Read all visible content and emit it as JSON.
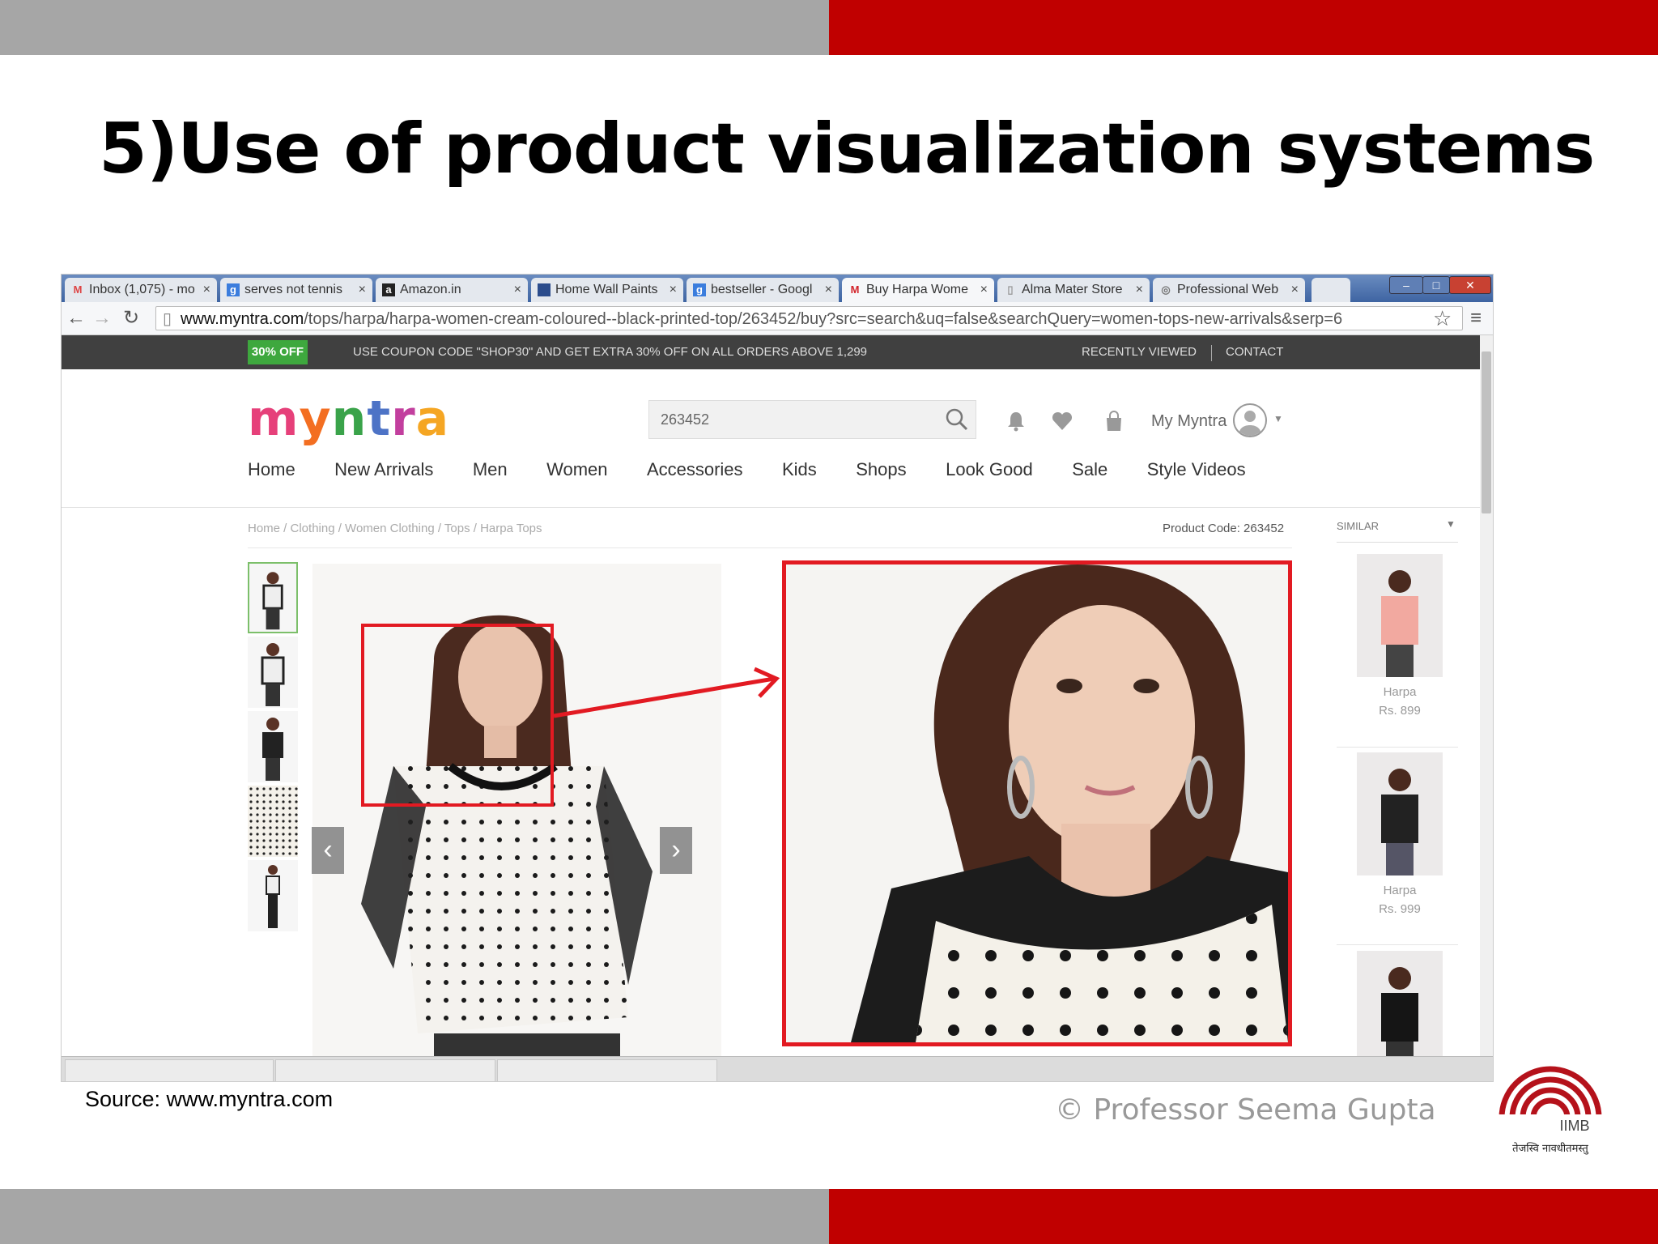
{
  "slide": {
    "title": "5)Use of product visualization systems",
    "source": "Source: www.myntra.com",
    "copyright": "© Professor Seema Gupta",
    "logo": {
      "acronym": "IIMB",
      "motto": "तेजस्वि नावधीतमस्तु"
    },
    "colors": {
      "accent": "#c00000",
      "band_gray": "#a6a6a6",
      "highlight": "#e21a22"
    }
  },
  "browser": {
    "tabs": [
      {
        "label": "Inbox (1,075) - mo",
        "icon": "gmail-icon"
      },
      {
        "label": "serves not tennis",
        "icon": "google-icon"
      },
      {
        "label": "Amazon.in",
        "icon": "amazon-icon"
      },
      {
        "label": "Home Wall Paints",
        "icon": "page-icon"
      },
      {
        "label": "bestseller - Googl",
        "icon": "google-icon"
      },
      {
        "label": "Buy Harpa Wome",
        "icon": "myntra-icon"
      },
      {
        "label": "Alma Mater Store",
        "icon": "page-icon"
      },
      {
        "label": "Professional Web",
        "icon": "globe-icon"
      }
    ],
    "url_host": "www.myntra.com",
    "url_path": "/tops/harpa/harpa-women-cream-coloured--black-printed-top/263452/buy?src=search&uq=false&searchQuery=women-tops-new-arrivals&serp=6"
  },
  "site": {
    "promo": {
      "badge": "30% OFF",
      "text": "USE COUPON CODE \"SHOP30\" AND GET EXTRA 30% OFF ON ALL ORDERS ABOVE 1,299",
      "recently_viewed": "RECENTLY VIEWED",
      "contact": "CONTACT"
    },
    "logo_text": "myntra",
    "search_value": "263452",
    "my_myntra": "My Myntra",
    "nav": [
      "Home",
      "New Arrivals",
      "Men",
      "Women",
      "Accessories",
      "Kids",
      "Shops",
      "Look Good",
      "Sale",
      "Style Videos"
    ],
    "breadcrumb": "Home / Clothing / Women Clothing / Tops / Harpa Tops",
    "product_code": "Product Code: 263452",
    "similar_label": "SIMILAR",
    "similar": [
      {
        "brand": "Harpa",
        "price": "Rs. 899"
      },
      {
        "brand": "Harpa",
        "price": "Rs. 999"
      }
    ]
  }
}
